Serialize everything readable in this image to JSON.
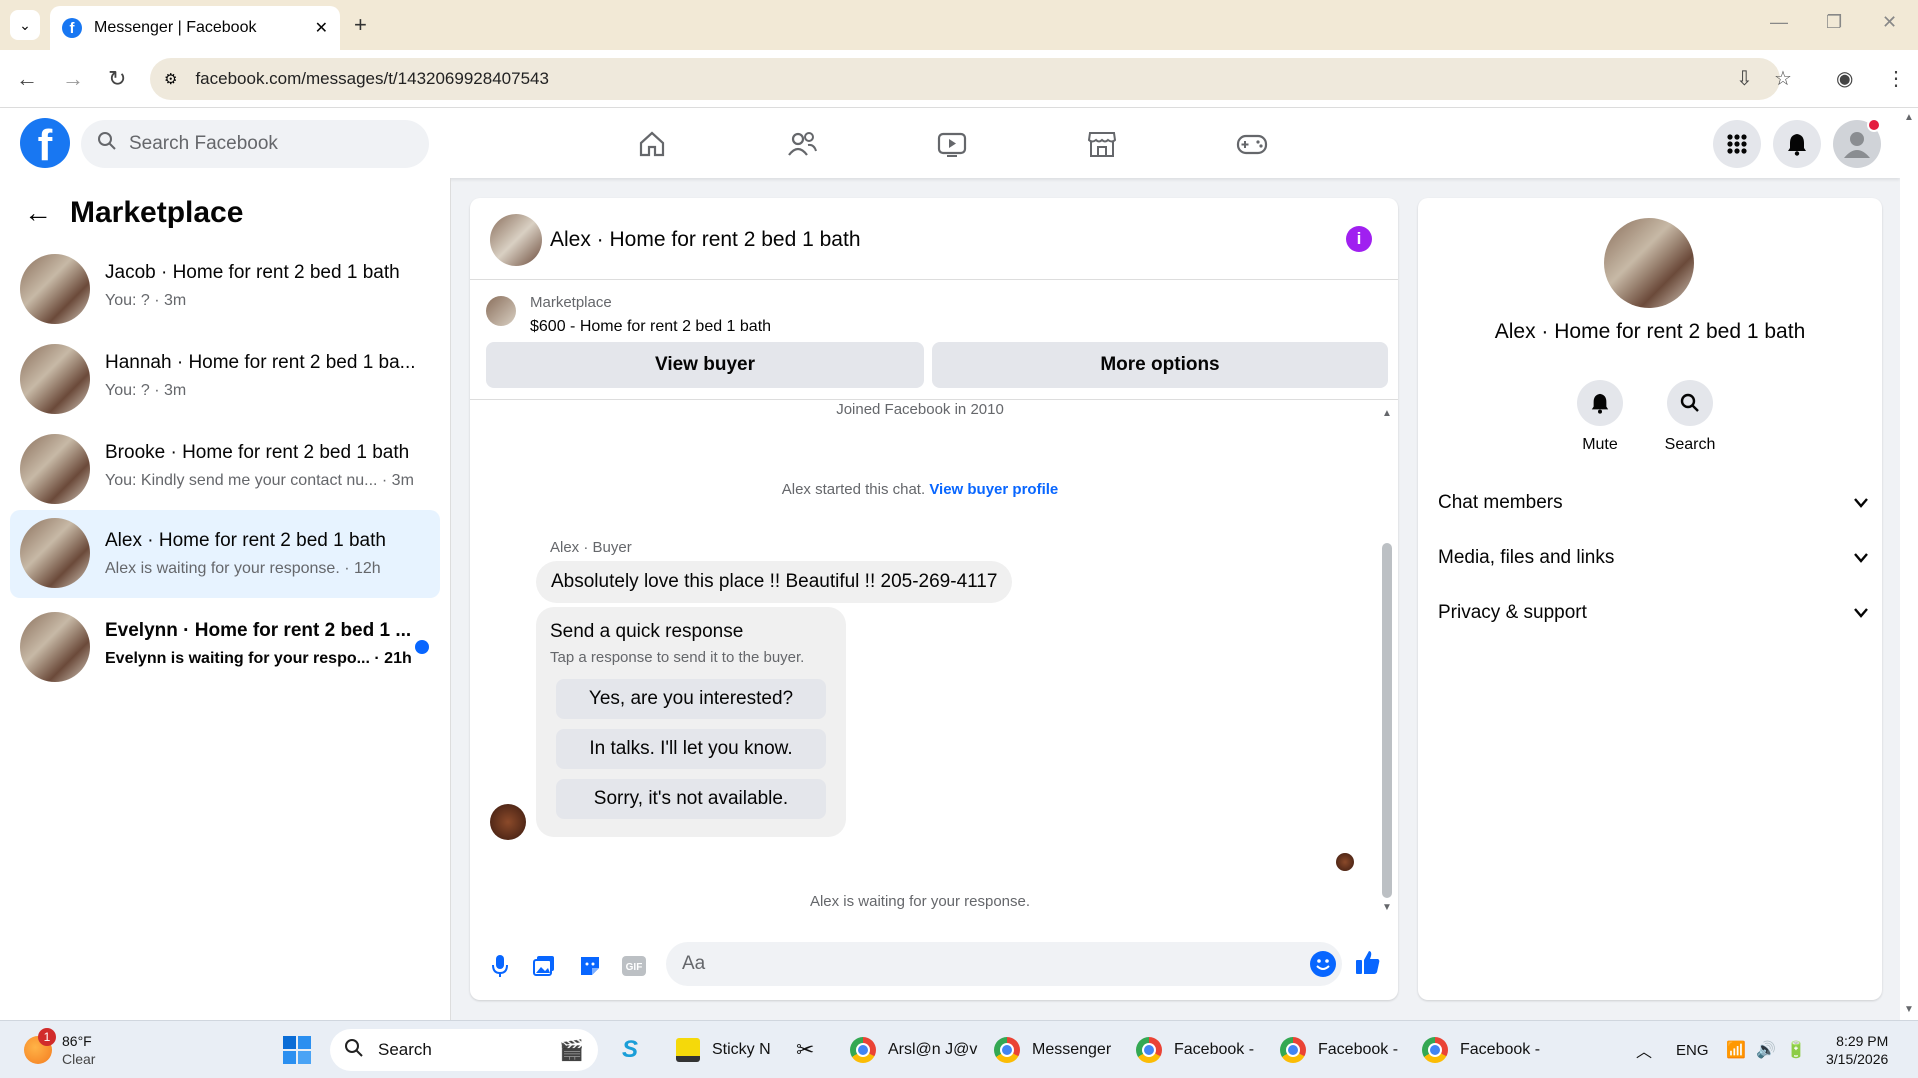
{
  "browser": {
    "tab_title": "Messenger | Facebook",
    "url": "facebook.com/messages/t/1432069928407543"
  },
  "fb_header": {
    "search_placeholder": "Search Facebook"
  },
  "left_panel": {
    "title": "Marketplace",
    "conversations": [
      {
        "name": "Jacob · Home for rent 2 bed 1 bath",
        "snippet": "You: ? · 3m"
      },
      {
        "name": "Hannah · Home for rent 2 bed 1 ba...",
        "snippet": "You: ? · 3m"
      },
      {
        "name": "Brooke · Home for rent 2 bed 1 bath",
        "snippet": "You: Kindly send me your contact nu... · 3m"
      },
      {
        "name": "Alex · Home for rent 2 bed 1 bath",
        "snippet": "Alex is waiting for your response. · 12h"
      },
      {
        "name": "Evelynn · Home for rent 2 bed 1 ...",
        "snippet": "Evelynn is waiting for your respo... · 21h"
      }
    ]
  },
  "chat": {
    "title": "Alex · Home for rent 2 bed 1 bath",
    "marketplace_label": "Marketplace",
    "listing": "$600 - Home for rent 2 bed 1 bath",
    "view_buyer": "View buyer",
    "more_options": "More options",
    "joined": "Joined Facebook in 2010",
    "started_text": "Alex started this chat.",
    "view_profile": "View buyer profile",
    "sender": "Alex · Buyer",
    "message": "Absolutely love this place !! Beautiful !! 205-269-4117",
    "quick_title": "Send a quick response",
    "quick_sub": "Tap a response to send it to the buyer.",
    "quick_responses": [
      "Yes, are you interested?",
      "In talks. I'll let you know.",
      "Sorry, it's not available."
    ],
    "waiting": "Alex is waiting for your response.",
    "input_placeholder": "Aa"
  },
  "right_panel": {
    "name": "Alex · Home for rent 2 bed 1 bath",
    "mute": "Mute",
    "search": "Search",
    "sections": [
      "Chat members",
      "Media, files and links",
      "Privacy & support"
    ]
  },
  "taskbar": {
    "weather_temp": "86°F",
    "weather_cond": "Clear",
    "weather_badge": "1",
    "search": "Search",
    "apps": [
      "Sticky N",
      "Arsl@n J@v",
      "Messenger",
      "Facebook -",
      "Facebook -",
      "Facebook -"
    ],
    "lang": "ENG",
    "time": "8:29 PM",
    "date": "3/15/2026"
  },
  "colors": {
    "fb_blue": "#1877f2",
    "messenger_blue": "#0866ff",
    "info_purple": "#a020f0",
    "selected_row": "#e7f3ff"
  }
}
